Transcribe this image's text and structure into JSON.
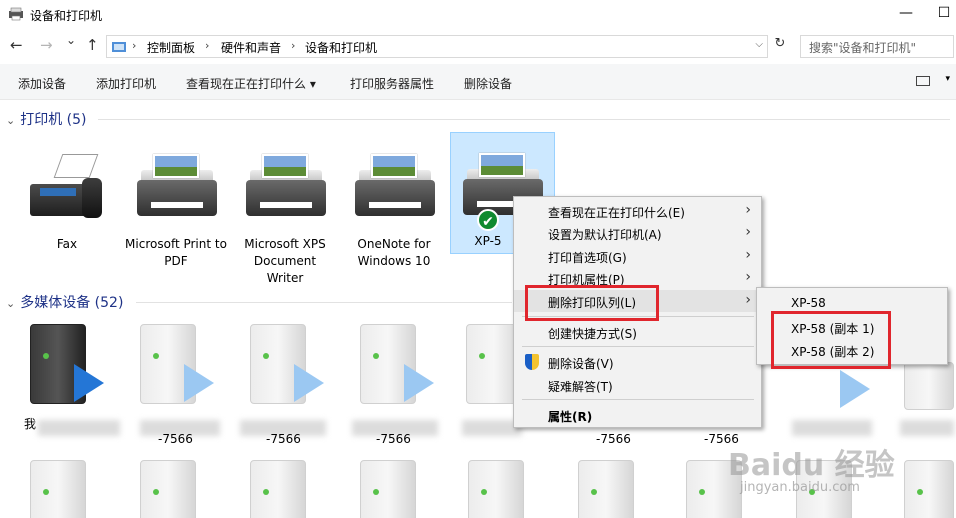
{
  "window": {
    "title": "设备和打印机",
    "minimize": "—",
    "maximize": "☐"
  },
  "nav": {
    "back": "←",
    "forward": "→",
    "recent": "⌄",
    "up": "↑",
    "breadcrumbs": [
      "控制面板",
      "硬件和声音",
      "设备和打印机"
    ],
    "separator": "›",
    "dropdown": "⌵",
    "refresh": "↻",
    "search_placeholder": "搜索\"设备和打印机\""
  },
  "toolbar": {
    "buttons": [
      "添加设备",
      "添加打印机",
      "查看现在正在打印什么 ▾",
      "打印服务器属性",
      "删除设备"
    ],
    "view_caret": "▾"
  },
  "groups": {
    "printers": {
      "label": "打印机 (5)",
      "chevron": "⌄"
    },
    "multimedia": {
      "label": "多媒体设备 (52)",
      "chevron": "⌄"
    }
  },
  "printers": [
    {
      "name": "Fax"
    },
    {
      "name": "Microsoft Print to PDF"
    },
    {
      "name": "Microsoft XPS Document Writer"
    },
    {
      "name": "OneNote for Windows 10"
    },
    {
      "name": "XP-58",
      "label_visible": "XP-5",
      "default_check": "✔"
    }
  ],
  "multimedia_labels": [
    "我",
    "-7566",
    "-7566",
    "-7566",
    "-7566",
    "-7566",
    "-7566"
  ],
  "context_menu": {
    "items": [
      {
        "label": "查看现在正在打印什么(E)",
        "arrow": "›"
      },
      {
        "label": "设置为默认打印机(A)",
        "arrow": "›"
      },
      {
        "label": "打印首选项(G)",
        "arrow": "›"
      },
      {
        "label": "打印机属性(P)",
        "arrow": "›"
      },
      {
        "label": "删除打印队列(L)",
        "arrow": "›"
      },
      {
        "label": "创建快捷方式(S)"
      },
      {
        "label": "删除设备(V)"
      },
      {
        "label": "疑难解答(T)"
      },
      {
        "label": "属性(R)"
      }
    ]
  },
  "submenu": {
    "items": [
      "XP-58",
      "XP-58 (副本 1)",
      "XP-58 (副本 2)"
    ]
  },
  "watermark": {
    "big": "Baidu 经验",
    "small": "jingyan.baidu.com"
  },
  "colors": {
    "highlight_box": "#e0262d",
    "group_header": "#1e3287",
    "selected_bg": "#cce8ff"
  }
}
